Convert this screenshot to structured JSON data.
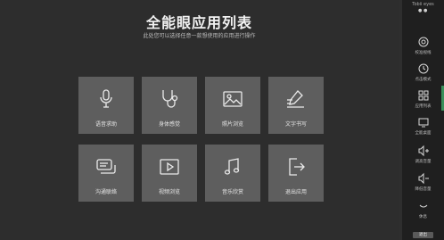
{
  "main": {
    "title": "全能眼应用列表",
    "subtitle": "此处您可以选择任意一款想使用的应用进行操作"
  },
  "tiles": [
    {
      "label": "语音求助",
      "icon": "microphone-icon"
    },
    {
      "label": "身体感觉",
      "icon": "stethoscope-icon"
    },
    {
      "label": "照片浏览",
      "icon": "image-icon"
    },
    {
      "label": "文字书写",
      "icon": "pencil-writing-icon"
    },
    {
      "label": "沟通联络",
      "icon": "chat-bubbles-icon"
    },
    {
      "label": "视频浏览",
      "icon": "video-play-icon"
    },
    {
      "label": "音乐欣赏",
      "icon": "music-note-icon"
    },
    {
      "label": "退出应用",
      "icon": "exit-icon"
    }
  ],
  "sidebar": {
    "header": "Tobii eyes",
    "toggle": "● ●",
    "items": [
      {
        "label": "校准视线",
        "icon": "calibrate-icon"
      },
      {
        "label": "点击模式",
        "icon": "clock-icon"
      },
      {
        "label": "应用列表",
        "icon": "grid-icon"
      },
      {
        "label": "全能桌面",
        "icon": "monitor-icon"
      },
      {
        "label": "调高音量",
        "icon": "volume-up-icon"
      },
      {
        "label": "降低音量",
        "icon": "volume-down-icon"
      },
      {
        "label": "休息",
        "icon": "rest-icon"
      }
    ],
    "bottom": "退出"
  }
}
